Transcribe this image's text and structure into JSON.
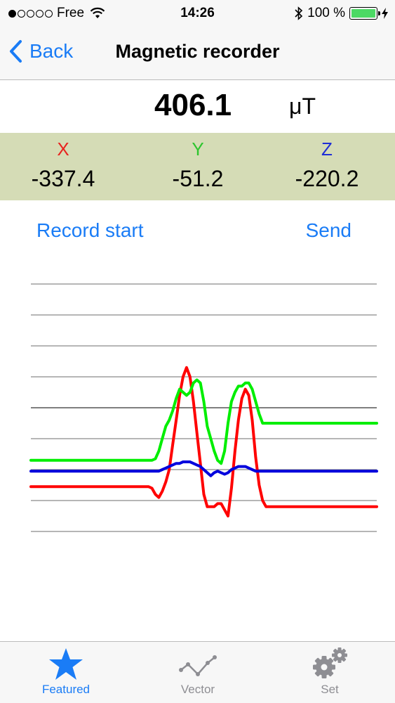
{
  "status_bar": {
    "carrier": "Free",
    "time": "14:26",
    "battery": "100 %",
    "signal_bars_filled": 1,
    "signal_bars_total": 5
  },
  "nav": {
    "back_label": "Back",
    "title": "Magnetic recorder"
  },
  "total": {
    "value": "406.1",
    "unit": "μT"
  },
  "axes": [
    {
      "label": "X",
      "value": "-337.4",
      "color": "#e8231f"
    },
    {
      "label": "Y",
      "value": "-51.2",
      "color": "#2ec52e"
    },
    {
      "label": "Z",
      "value": "-220.2",
      "color": "#1f2ed6"
    }
  ],
  "actions": {
    "record_label": "Record start",
    "send_label": "Send"
  },
  "colors": {
    "accent": "#1a7cf6",
    "band": "#d5dcb6",
    "x_series": "#ff0000",
    "y_series": "#00ee00",
    "z_series": "#0000dd"
  },
  "chart_data": {
    "type": "line",
    "grid": true,
    "x": [
      0,
      1,
      2,
      3,
      4,
      5,
      6,
      7,
      8,
      9,
      10,
      11,
      12,
      13,
      14,
      15,
      16,
      17,
      18,
      19,
      20,
      21,
      22,
      23,
      24,
      25,
      26,
      27,
      28,
      29,
      30,
      31,
      32,
      33,
      34,
      35,
      36,
      37,
      38,
      39,
      40,
      41,
      42,
      43,
      44,
      45,
      46,
      47,
      48,
      49,
      50,
      51,
      52,
      53,
      54,
      55,
      56,
      57,
      58,
      59,
      60,
      61,
      62,
      63,
      64,
      65,
      66,
      67,
      68,
      69,
      70,
      71,
      72,
      73,
      74,
      75,
      76,
      77,
      78,
      79,
      80,
      81,
      82,
      83,
      84,
      85,
      86,
      87,
      88,
      89,
      90,
      91,
      92,
      93,
      94,
      95,
      96,
      97,
      98,
      99,
      100
    ],
    "ylim": [
      0,
      8
    ],
    "series": [
      {
        "id": "x",
        "color": "#ff0000",
        "values": [
          1.45,
          1.45,
          1.45,
          1.45,
          1.45,
          1.45,
          1.45,
          1.45,
          1.45,
          1.45,
          1.45,
          1.45,
          1.45,
          1.45,
          1.45,
          1.45,
          1.45,
          1.45,
          1.45,
          1.45,
          1.45,
          1.45,
          1.45,
          1.45,
          1.45,
          1.45,
          1.45,
          1.45,
          1.45,
          1.45,
          1.45,
          1.45,
          1.45,
          1.45,
          1.45,
          1.4,
          1.2,
          1.1,
          1.3,
          1.6,
          2.0,
          2.8,
          3.6,
          4.4,
          5.0,
          5.3,
          5.0,
          4.2,
          3.2,
          2.2,
          1.2,
          0.8,
          0.8,
          0.8,
          0.9,
          0.9,
          0.7,
          0.5,
          1.4,
          2.6,
          3.6,
          4.3,
          4.6,
          4.4,
          3.6,
          2.4,
          1.5,
          1.0,
          0.8,
          0.8,
          0.8,
          0.8,
          0.8,
          0.8,
          0.8,
          0.8,
          0.8,
          0.8,
          0.8,
          0.8,
          0.8,
          0.8,
          0.8,
          0.8,
          0.8,
          0.8,
          0.8,
          0.8,
          0.8,
          0.8,
          0.8,
          0.8,
          0.8,
          0.8,
          0.8,
          0.8,
          0.8,
          0.8,
          0.8,
          0.8,
          0.8
        ]
      },
      {
        "id": "y",
        "color": "#00ee00",
        "values": [
          2.3,
          2.3,
          2.3,
          2.3,
          2.3,
          2.3,
          2.3,
          2.3,
          2.3,
          2.3,
          2.3,
          2.3,
          2.3,
          2.3,
          2.3,
          2.3,
          2.3,
          2.3,
          2.3,
          2.3,
          2.3,
          2.3,
          2.3,
          2.3,
          2.3,
          2.3,
          2.3,
          2.3,
          2.3,
          2.3,
          2.3,
          2.3,
          2.3,
          2.3,
          2.3,
          2.3,
          2.35,
          2.6,
          3.0,
          3.4,
          3.6,
          3.9,
          4.3,
          4.6,
          4.5,
          4.4,
          4.5,
          4.8,
          4.9,
          4.8,
          4.2,
          3.4,
          3.0,
          2.6,
          2.3,
          2.2,
          2.6,
          3.5,
          4.2,
          4.5,
          4.7,
          4.7,
          4.8,
          4.8,
          4.6,
          4.2,
          3.8,
          3.5,
          3.5,
          3.5,
          3.5,
          3.5,
          3.5,
          3.5,
          3.5,
          3.5,
          3.5,
          3.5,
          3.5,
          3.5,
          3.5,
          3.5,
          3.5,
          3.5,
          3.5,
          3.5,
          3.5,
          3.5,
          3.5,
          3.5,
          3.5,
          3.5,
          3.5,
          3.5,
          3.5,
          3.5,
          3.5,
          3.5,
          3.5,
          3.5,
          3.5
        ]
      },
      {
        "id": "z",
        "color": "#0000dd",
        "values": [
          1.95,
          1.95,
          1.95,
          1.95,
          1.95,
          1.95,
          1.95,
          1.95,
          1.95,
          1.95,
          1.95,
          1.95,
          1.95,
          1.95,
          1.95,
          1.95,
          1.95,
          1.95,
          1.95,
          1.95,
          1.95,
          1.95,
          1.95,
          1.95,
          1.95,
          1.95,
          1.95,
          1.95,
          1.95,
          1.95,
          1.95,
          1.95,
          1.95,
          1.95,
          1.95,
          1.95,
          1.95,
          1.95,
          2.0,
          2.05,
          2.1,
          2.15,
          2.2,
          2.2,
          2.25,
          2.25,
          2.25,
          2.2,
          2.15,
          2.1,
          2.0,
          1.9,
          1.8,
          1.9,
          1.95,
          1.9,
          1.85,
          1.9,
          2.0,
          2.05,
          2.1,
          2.1,
          2.1,
          2.05,
          2.0,
          1.95,
          1.95,
          1.95,
          1.95,
          1.95,
          1.95,
          1.95,
          1.95,
          1.95,
          1.95,
          1.95,
          1.95,
          1.95,
          1.95,
          1.95,
          1.95,
          1.95,
          1.95,
          1.95,
          1.95,
          1.95,
          1.95,
          1.95,
          1.95,
          1.95,
          1.95,
          1.95,
          1.95,
          1.95,
          1.95,
          1.95,
          1.95,
          1.95,
          1.95,
          1.95,
          1.95
        ]
      }
    ]
  },
  "tabs": [
    {
      "label": "Featured",
      "icon": "star-icon",
      "active": true
    },
    {
      "label": "Vector",
      "icon": "vector-icon",
      "active": false
    },
    {
      "label": "Set",
      "icon": "gear-icon",
      "active": false
    }
  ]
}
